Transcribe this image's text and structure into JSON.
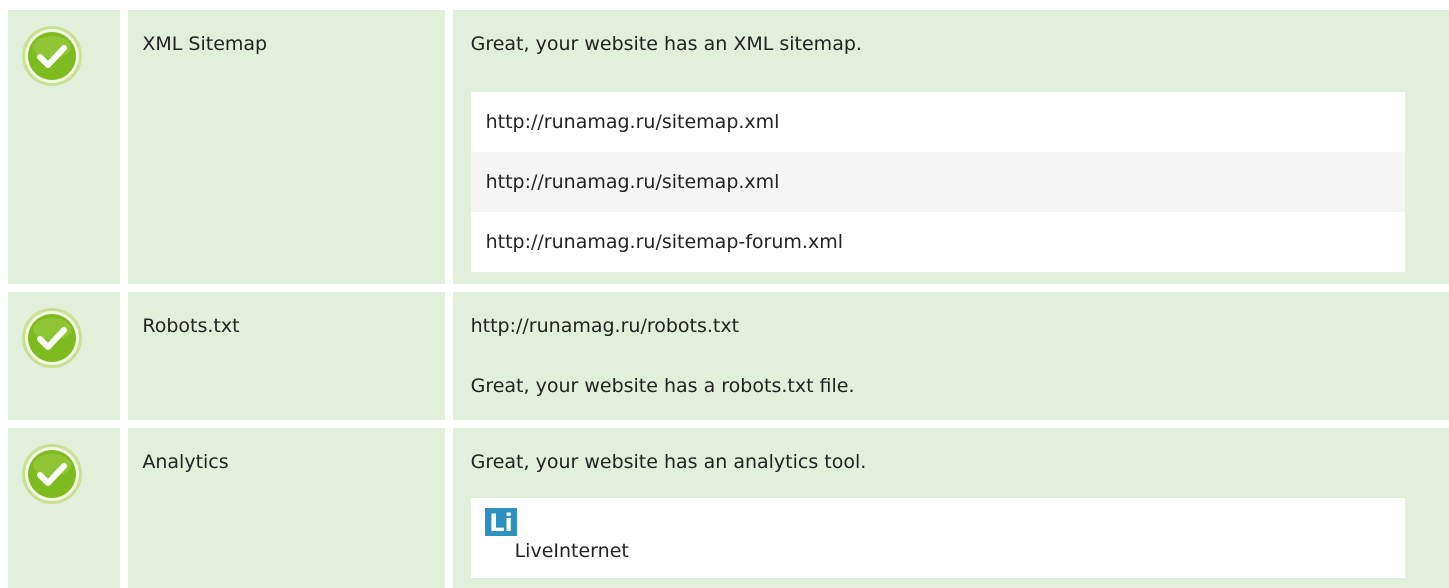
{
  "checks": [
    {
      "name": "XML Sitemap",
      "status": "pass",
      "message": "Great, your website has an XML sitemap.",
      "sitemaps": [
        "http://runamag.ru/sitemap.xml",
        "http://runamag.ru/sitemap.xml",
        "http://runamag.ru/sitemap-forum.xml"
      ]
    },
    {
      "name": "Robots.txt",
      "status": "pass",
      "url": "http://runamag.ru/robots.txt",
      "message": "Great, your website has a robots.txt file."
    },
    {
      "name": "Analytics",
      "status": "pass",
      "message": "Great, your website has an analytics tool.",
      "tools": [
        {
          "name": "LiveInternet",
          "logo_text": "Li",
          "icon": "liveinternet-logo-icon"
        }
      ]
    }
  ],
  "icons": {
    "status_pass": "check-circle-icon"
  },
  "colors": {
    "row_background": "#e1efdb",
    "check_green": "#7dbb1f",
    "check_ring": "#d6e8a8",
    "list_stripe": "#f5f5f5",
    "logo_blue": "#2e8fc1",
    "text": "#222222"
  }
}
